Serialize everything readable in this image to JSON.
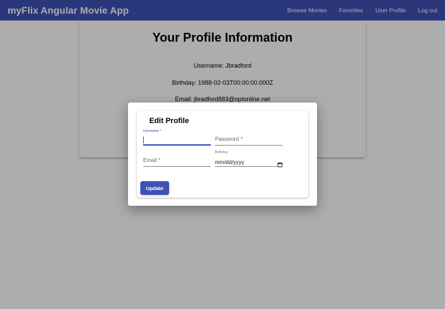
{
  "toolbar": {
    "title": "myFlix Angular Movie App",
    "nav": [
      "Browse Movies",
      "Favorites",
      "User Profile",
      "Log out"
    ]
  },
  "profile": {
    "heading": "Your Profile Information",
    "username_line": "Username: Jbradford",
    "birthday_line": "Birthday: 1988-02-03T00:00:00.000Z",
    "email_line": "Email: jbradford883@optonline.net"
  },
  "dialog": {
    "title": "Edit Profile",
    "fields": {
      "username": {
        "label": "Username *",
        "value": ""
      },
      "password": {
        "placeholder": "Password *"
      },
      "email": {
        "placeholder": "Email *"
      },
      "birthday": {
        "label": "Birthday",
        "value": "mm/dd/yyyy"
      }
    },
    "update_label": "Update"
  },
  "colors": {
    "primary": "#3f51b5",
    "backdrop": "rgba(0,0,0,0.32)"
  }
}
